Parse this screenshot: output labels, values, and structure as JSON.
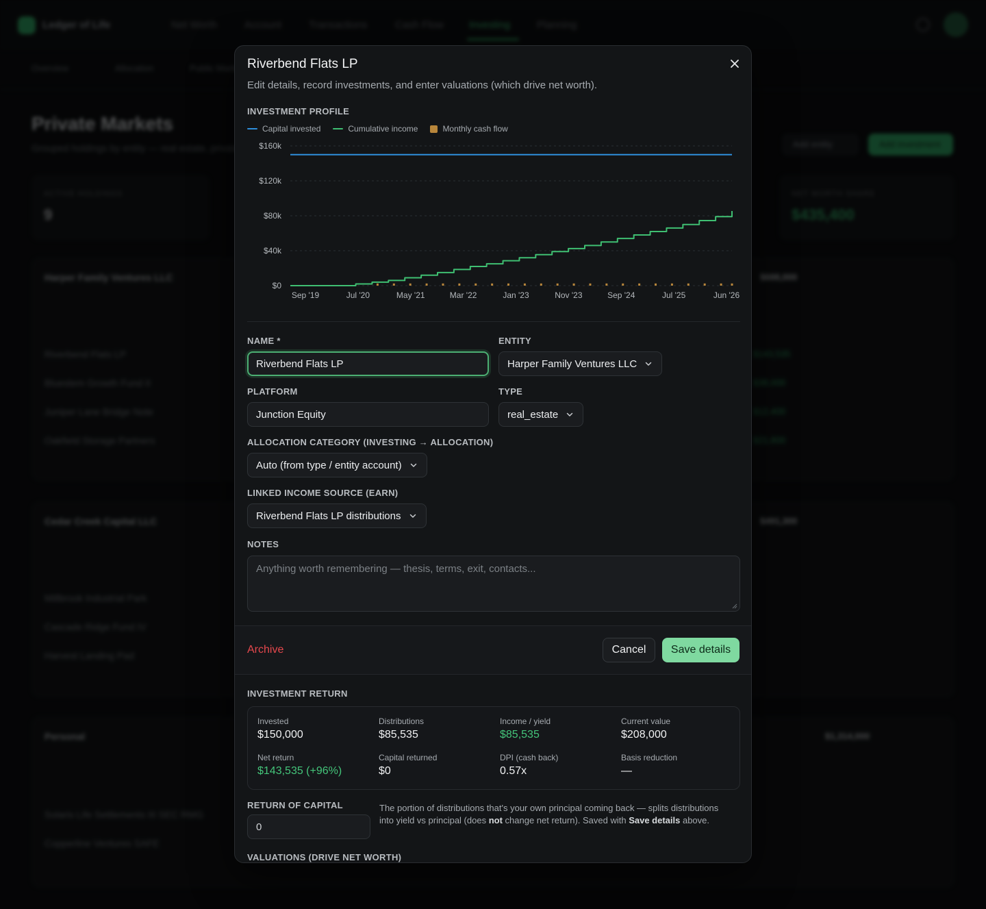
{
  "modal": {
    "title": "Riverbend Flats LP",
    "description": "Edit details, record investments, and enter valuations (which drive net worth)."
  },
  "profile": {
    "section_label": "INVESTMENT PROFILE",
    "legend": [
      {
        "label": "Capital invested",
        "color": "#2f8fdc"
      },
      {
        "label": "Cumulative income",
        "color": "#3fbf72"
      },
      {
        "label": "Monthly cash flow",
        "color": "#b8863b"
      }
    ]
  },
  "chart_data": {
    "type": "line",
    "title": "",
    "xlabel": "",
    "ylabel": "",
    "ylim": [
      0,
      160000
    ],
    "yticks": [
      "$0",
      "$40k",
      "$80k",
      "$120k",
      "$160k"
    ],
    "ytick_values": [
      0,
      40000,
      80000,
      120000,
      160000
    ],
    "x_tick_labels": [
      "Sep '19",
      "Jul '20",
      "May '21",
      "Mar '22",
      "Jan '23",
      "Nov '23",
      "Sep '24",
      "Jul '25",
      "Jun '26"
    ],
    "x_range": [
      "2019-09",
      "2026-06"
    ],
    "grid": "horizontal-dashed",
    "legend_position": "top-left",
    "series": [
      {
        "name": "Capital invested",
        "color": "#2f8fdc",
        "kind": "line",
        "points": [
          [
            "2019-09",
            150000
          ],
          [
            "2026-06",
            150000
          ]
        ]
      },
      {
        "name": "Cumulative income",
        "color": "#3fbf72",
        "kind": "step",
        "points": [
          [
            "2019-09",
            0
          ],
          [
            "2020-06",
            0
          ],
          [
            "2020-09",
            2000
          ],
          [
            "2020-12",
            4000
          ],
          [
            "2021-03",
            6000
          ],
          [
            "2021-06",
            9000
          ],
          [
            "2021-09",
            12000
          ],
          [
            "2021-12",
            15000
          ],
          [
            "2022-03",
            18500
          ],
          [
            "2022-06",
            22000
          ],
          [
            "2022-09",
            25000
          ],
          [
            "2022-12",
            28500
          ],
          [
            "2023-03",
            32000
          ],
          [
            "2023-06",
            35500
          ],
          [
            "2023-09",
            39000
          ],
          [
            "2023-12",
            42500
          ],
          [
            "2024-03",
            46000
          ],
          [
            "2024-06",
            50000
          ],
          [
            "2024-09",
            54000
          ],
          [
            "2024-12",
            58000
          ],
          [
            "2025-03",
            62000
          ],
          [
            "2025-06",
            66000
          ],
          [
            "2025-09",
            70000
          ],
          [
            "2025-12",
            74500
          ],
          [
            "2026-03",
            79000
          ],
          [
            "2026-06",
            85535
          ]
        ]
      },
      {
        "name": "Monthly cash flow",
        "color": "#b8863b",
        "kind": "bar",
        "points": [
          [
            "2021-01",
            2500
          ],
          [
            "2021-04",
            2500
          ],
          [
            "2021-07",
            2500
          ],
          [
            "2021-10",
            2500
          ],
          [
            "2022-01",
            2500
          ],
          [
            "2022-04",
            2500
          ],
          [
            "2022-07",
            2500
          ],
          [
            "2022-10",
            2500
          ],
          [
            "2023-01",
            2500
          ],
          [
            "2023-04",
            2500
          ],
          [
            "2023-07",
            2500
          ],
          [
            "2023-10",
            2500
          ],
          [
            "2024-01",
            2500
          ],
          [
            "2024-04",
            2500
          ],
          [
            "2024-07",
            2500
          ],
          [
            "2024-10",
            2500
          ],
          [
            "2025-01",
            2500
          ],
          [
            "2025-04",
            2500
          ],
          [
            "2025-07",
            2500
          ],
          [
            "2025-10",
            2500
          ],
          [
            "2026-01",
            2500
          ],
          [
            "2026-04",
            2500
          ],
          [
            "2026-06",
            2500
          ]
        ]
      }
    ]
  },
  "form": {
    "name_label": "NAME *",
    "name_value": "Riverbend Flats LP",
    "entity_label": "ENTITY",
    "entity_value": "Harper Family Ventures LLC",
    "platform_label": "PLATFORM",
    "platform_value": "Junction Equity",
    "type_label": "TYPE",
    "type_value": "real_estate",
    "allocation_label": "ALLOCATION CATEGORY (INVESTING → ALLOCATION)",
    "allocation_value": "Auto (from type / entity account)",
    "income_label": "LINKED INCOME SOURCE (EARN)",
    "income_value": "Riverbend Flats LP distributions",
    "notes_label": "NOTES",
    "notes_placeholder": "Anything worth remembering — thesis, terms, exit, contacts..."
  },
  "footer": {
    "archive_label": "Archive",
    "cancel_label": "Cancel",
    "save_label": "Save details"
  },
  "investment_return": {
    "section_label": "INVESTMENT RETURN",
    "invested_label": "Invested",
    "invested_value": "$150,000",
    "distributions_label": "Distributions",
    "distributions_value": "$85,535",
    "income_label": "Income / yield",
    "income_value": "$85,535",
    "current_label": "Current value",
    "current_value": "$208,000",
    "net_label": "Net return",
    "net_value": "$143,535 (+96%)",
    "capital_returned_label": "Capital returned",
    "capital_returned_value": "$0",
    "dpi_label": "DPI (cash back)",
    "dpi_value": "0.57x",
    "basis_label": "Basis reduction",
    "basis_value": "—"
  },
  "return_of_capital": {
    "section_label": "RETURN OF CAPITAL",
    "value": "0",
    "help_1": "The portion of distributions that's your own principal coming back — splits distributions into yield vs principal (does ",
    "help_not": "not",
    "help_2": " change net return). Saved with ",
    "help_save": "Save details",
    "help_3": " above."
  },
  "valuations": {
    "section_label": "VALUATIONS (DRIVE NET WORTH)"
  },
  "background": {
    "brand": "Ledger of Life",
    "nav": [
      "Net Worth",
      "Account",
      "Transactions",
      "Cash Flow",
      "Investing",
      "Planning"
    ],
    "subnav": [
      "Overview",
      "Allocation",
      "Public Markets"
    ],
    "page_title": "Private Markets",
    "page_subtitle": "Grouped holdings by entity — real estate, private funds",
    "add_entity": "Add entity",
    "add_investment": "Add investment",
    "stats": [
      {
        "label": "ACTIVE HOLDINGS",
        "value": "9"
      },
      {
        "label": "NET WORTH SHARE",
        "value": "$435,400"
      }
    ],
    "groups": [
      {
        "name": "Harper Family Ventures LLC",
        "total": "$688,000",
        "rows": [
          "Riverbend Flats LP",
          "Bluestem Growth Fund II",
          "Juniper Lane Bridge Note",
          "Oakfield Storage Partners"
        ]
      },
      {
        "name": "Cedar Creek Capital LLC",
        "total": "$491,300",
        "rows": [
          "Millbrook Industrial Park",
          "Cascade Ridge Fund IV",
          "Harvest Landing Pad"
        ]
      },
      {
        "name": "Personal",
        "total": "$1,314,000",
        "rows": [
          "Solaris Life Settlements III SEC RMG",
          "Copperline Ventures SAFE"
        ]
      }
    ]
  }
}
